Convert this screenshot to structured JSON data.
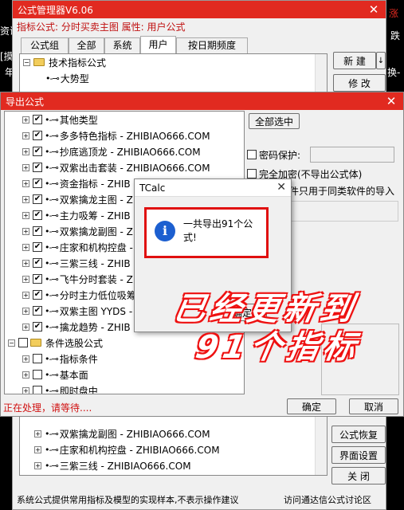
{
  "bg": {
    "left_top": "资讯",
    "left_mid": "[摸大",
    "left_low": "年",
    "right_top": "涨",
    "right_mid": "跌",
    "right_low": "换-"
  },
  "main": {
    "title": "公式管理器V6.06",
    "info": "指标公式: 分时买卖主图  属性: 用户公式",
    "tabs": [
      "公式组",
      "全部",
      "系统",
      "用户",
      "按日期频度"
    ],
    "tree_top": [
      "技术指标公式",
      "大势型"
    ],
    "btn_new": "新 建",
    "btn_edit": "修 改",
    "tree_bottom": [
      "双紫擒龙副图 - ZHIBIAO666.COM",
      "庄家和机构控盘 - ZHIBIAO666.COM",
      "三紫三线 - ZHIBIAO666.COM"
    ],
    "btn_restore": "公式恢复",
    "btn_ui": "界面设置",
    "btn_close": "关 闭",
    "status": "系统公式提供常用指标及模型的实现样本,不表示操作建议",
    "link": "访问通达信公式讨论区"
  },
  "export": {
    "title": "导出公式",
    "items": [
      "其他类型",
      "多多特色指标 - ZHIBIAO666.COM",
      "抄底逃顶龙 - ZHIBIAO666.COM",
      "双紫出击套装 - ZHIBIAO666.COM",
      "资金指标 - ZHIB",
      "双紫擒龙主图 - Z",
      "主力吸筹 - ZHIB",
      "双紫擒龙副图 - Z",
      "庄家和机构控盘 -",
      "三紫三线 - ZHIB",
      "飞牛分时套装 - Z",
      "分时主力低位吸筹",
      "双紫主图 YYDS -",
      "擒龙趋势 - ZHIB"
    ],
    "cond_group": "条件选股公式",
    "cond_items": [
      "指标条件",
      "基本面",
      "即时盘中"
    ],
    "select_all": "全部选中",
    "pwd_label": "密码保护:",
    "encrypt_label": "完全加密(不导出公式体)",
    "only_label": "件只用于同类软件的导入",
    "status": "正在处理，请等待....",
    "ok": "确定",
    "cancel": "取消"
  },
  "dialog": {
    "title": "TCalc",
    "message": "一共导出91个公式!",
    "ok": "确定"
  },
  "overlay": {
    "line1": "已经更新到",
    "line2": "91个指标"
  },
  "colors": {
    "accent": "#e12a20",
    "info": "#1c5fd0"
  }
}
